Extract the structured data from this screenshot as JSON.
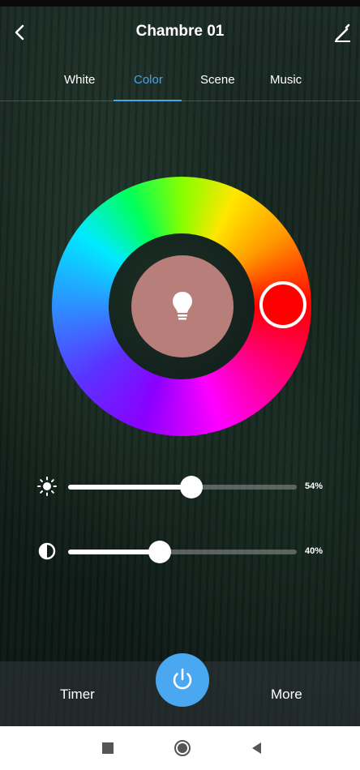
{
  "header": {
    "title": "Chambre 01",
    "back_icon": "chevron-left-icon",
    "edit_icon": "pencil-icon"
  },
  "tabs": [
    {
      "label": "White",
      "active": false
    },
    {
      "label": "Color",
      "active": true
    },
    {
      "label": "Scene",
      "active": false
    },
    {
      "label": "Music",
      "active": false
    }
  ],
  "color_wheel": {
    "selected_color": "#ff0000",
    "center_color": "#b87e79",
    "center_icon": "lightbulb-icon"
  },
  "sliders": {
    "brightness": {
      "icon": "sun-icon",
      "value": 54,
      "label": "54%"
    },
    "saturation": {
      "icon": "contrast-icon",
      "value": 40,
      "label": "40%"
    }
  },
  "bottom": {
    "timer_label": "Timer",
    "more_label": "More",
    "power_icon": "power-icon",
    "power_color": "#4aa8f0"
  },
  "navbar": {
    "icons": [
      "square-icon",
      "circle-icon",
      "triangle-back-icon"
    ]
  },
  "colors": {
    "accent": "#4aa3ea"
  }
}
